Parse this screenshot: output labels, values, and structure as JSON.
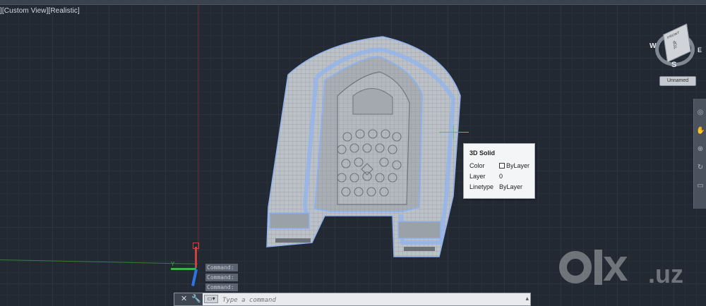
{
  "viewport": {
    "view_label": "][Custom View][Realistic]"
  },
  "tooltip": {
    "title": "3D Solid",
    "rows": [
      {
        "label": "Color",
        "value": "ByLayer",
        "swatch": true
      },
      {
        "label": "Layer",
        "value": "0"
      },
      {
        "label": "Linetype",
        "value": "ByLayer"
      }
    ]
  },
  "viewcube": {
    "top": "TOP",
    "face": "FRONT",
    "north": "W",
    "east": "E",
    "south": "S",
    "wcs_menu": "Unnamed"
  },
  "ucs": {
    "x_label": "Y"
  },
  "command_history": [
    "Command:",
    "Command:",
    "Command:"
  ],
  "command_line": {
    "placeholder": "Type a command"
  },
  "watermark": {
    "brand": "x",
    "suffix": ".uz"
  },
  "colors": {
    "background": "#222933",
    "model_face": "#bfc4c9",
    "model_edge_highlight": "#8fb3f0",
    "axis_x": "#3cb34a",
    "axis_y": "#2f74e6",
    "axis_z": "#d14040"
  }
}
